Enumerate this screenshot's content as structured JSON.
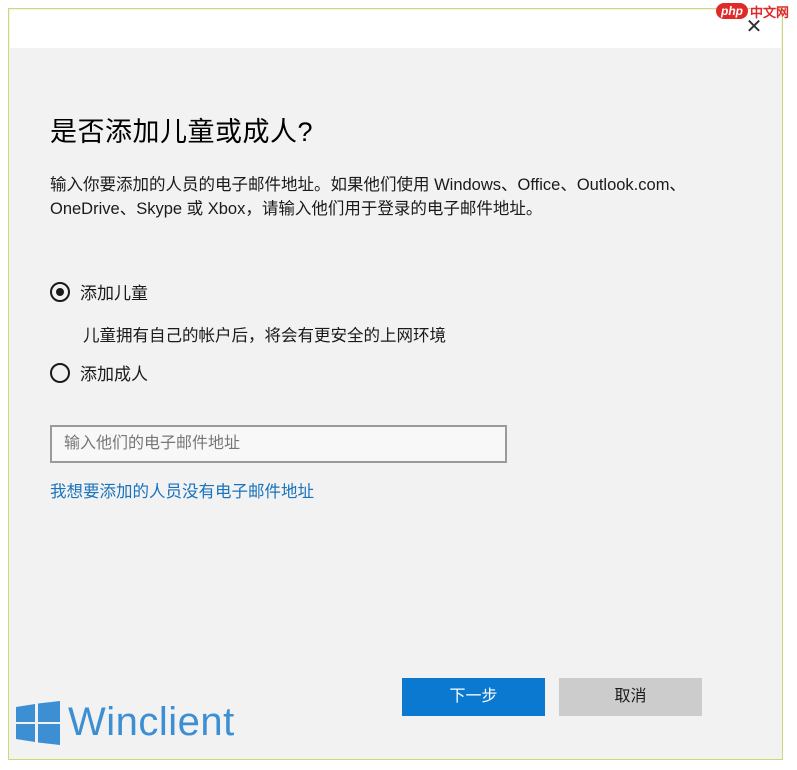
{
  "dialog": {
    "close_glyph": "✕",
    "heading": "是否添加儿童或成人?",
    "description": "输入你要添加的人员的电子邮件地址。如果他们使用 Windows、Office、Outlook.com、OneDrive、Skype 或 Xbox，请输入他们用于登录的电子邮件地址。",
    "options": [
      {
        "label": "添加儿童",
        "selected": true,
        "subtext": "儿童拥有自己的帐户后，将会有更安全的上网环境"
      },
      {
        "label": "添加成人",
        "selected": false
      }
    ],
    "email_input": {
      "value": "",
      "placeholder": "输入他们的电子邮件地址"
    },
    "no_email_link": "我想要添加的人员没有电子邮件地址",
    "buttons": {
      "next": "下一步",
      "cancel": "取消"
    }
  },
  "watermark": {
    "php": "php",
    "site": "中文网"
  },
  "brand": {
    "text": "Winclient"
  },
  "colors": {
    "accent": "#0b79d0",
    "link": "#1973bd",
    "cancel_bg": "#cccccc",
    "brand": "#3d8fd4",
    "dialog_bg": "#f2f2f2"
  }
}
